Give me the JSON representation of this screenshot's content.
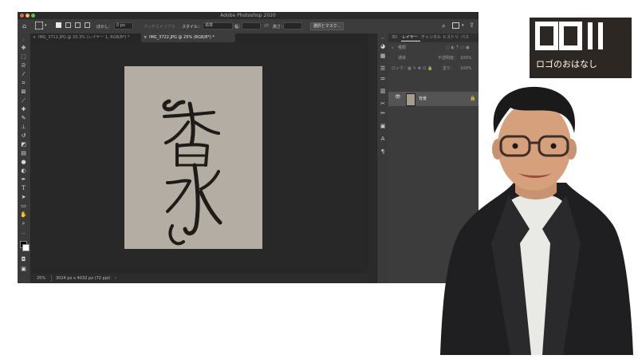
{
  "app": {
    "title": "Adobe Photoshop 2020"
  },
  "options_bar": {
    "feather_label": "ぼかし：",
    "feather_value": "0 px",
    "antialias_label": "アンチエイリアス",
    "style_label": "スタイル：",
    "style_value": "標準",
    "width_label": "幅：",
    "height_label": "高さ：",
    "select_mask_button": "選択とマスク..."
  },
  "tabs": [
    {
      "label": "IMG_3711.JPG @ 33.3% (レイヤー 1, RGB/8*) *",
      "close": "×"
    },
    {
      "label": "IMG_3722.JPG @ 25% (RGB/8*) *",
      "close": "×"
    }
  ],
  "status_bar": {
    "zoom": "25%",
    "doc_info": "3024 px x 4032 px (72 ppi)",
    "arrow": "›"
  },
  "panel": {
    "tabs": [
      "3D",
      "レイヤー",
      "チャンネル",
      "ヒストリ",
      "パス"
    ],
    "active_tab": "レイヤー",
    "search_kind": "種類",
    "blend_mode": "通常",
    "opacity_label": "不透明度：",
    "opacity_value": "100%",
    "lock_label": "ロック：",
    "fill_label": "塗り：",
    "fill_value": "100%",
    "layers": [
      {
        "name": "背景",
        "visible": true,
        "locked": true
      }
    ]
  },
  "canvas": {
    "calligraphy_text": "香水",
    "paper_color": "#b4ada3"
  },
  "overlay": {
    "logo_caption": "ロゴのおはなし"
  },
  "colors": {
    "app_bg": "#323232",
    "panel_bg": "#3c3c3c",
    "canvas_bg": "#282828",
    "ink": "#1e1b18",
    "jacket": "#1f1f21",
    "shirt": "#e9e9e6"
  },
  "icons": [
    "home-icon",
    "marquee-icon",
    "move-tool-icon",
    "lasso-icon",
    "magic-wand-icon",
    "crop-icon",
    "eyedropper-icon",
    "brush-icon",
    "stamp-icon",
    "eraser-icon",
    "gradient-icon",
    "pen-icon",
    "type-icon",
    "path-select-icon",
    "rectangle-icon",
    "hand-icon",
    "zoom-icon",
    "search-icon",
    "share-icon",
    "eye-icon",
    "lock-icon",
    "trash-icon"
  ]
}
